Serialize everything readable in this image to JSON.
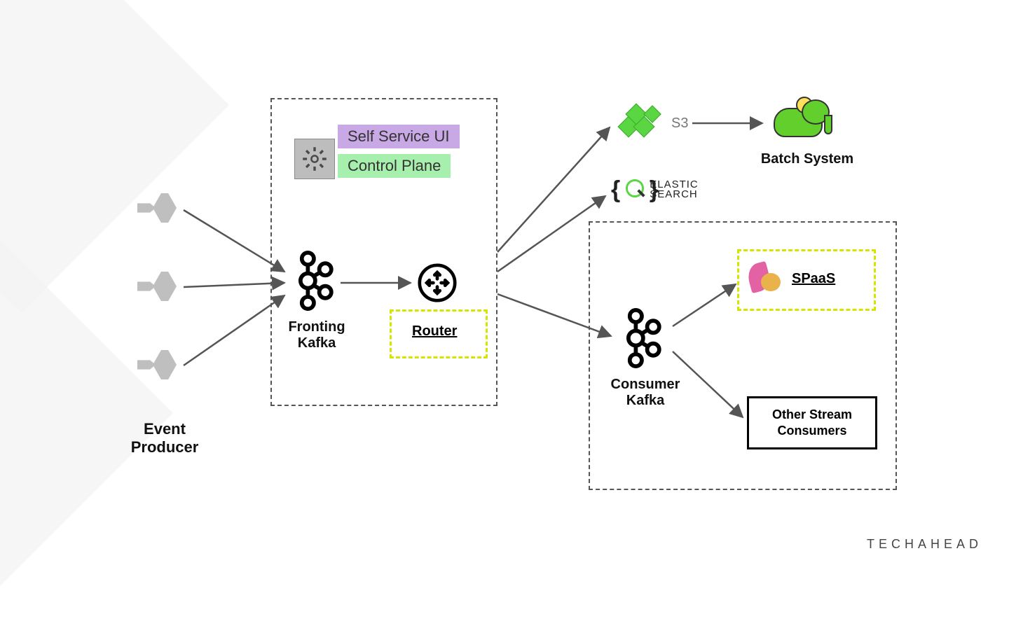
{
  "labels": {
    "event_producer": "Event\nProducer",
    "self_service_ui": "Self Service UI",
    "control_plane": "Control Plane",
    "fronting_kafka": "Fronting\nKafka",
    "router": "Router",
    "s3": "S3",
    "elastic1": "ELASTIC",
    "elastic2": "SEARCH",
    "batch_system": "Batch System",
    "consumer_kafka": "Consumer\nKafka",
    "spaas": "SPaaS",
    "other_stream_consumers": "Other Stream\nConsumers"
  },
  "brand": "TECHAHEAD",
  "colors": {
    "purple": "#c9a8e6",
    "green_bar": "#a7efac",
    "lime": "#59d642",
    "yellow_dash": "#d4e600"
  },
  "nodes": [
    {
      "id": "producer1",
      "type": "producer"
    },
    {
      "id": "producer2",
      "type": "producer"
    },
    {
      "id": "producer3",
      "type": "producer"
    },
    {
      "id": "gear",
      "type": "gear"
    },
    {
      "id": "fronting_kafka",
      "type": "kafka"
    },
    {
      "id": "router",
      "type": "router"
    },
    {
      "id": "s3",
      "type": "s3"
    },
    {
      "id": "elasticsearch",
      "type": "elasticsearch"
    },
    {
      "id": "hadoop",
      "type": "hadoop"
    },
    {
      "id": "consumer_kafka",
      "type": "kafka"
    },
    {
      "id": "spaas",
      "type": "spaas"
    },
    {
      "id": "other_consumers",
      "type": "box"
    }
  ],
  "edges": [
    {
      "from": "producer1",
      "to": "fronting_kafka"
    },
    {
      "from": "producer2",
      "to": "fronting_kafka"
    },
    {
      "from": "producer3",
      "to": "fronting_kafka"
    },
    {
      "from": "fronting_kafka",
      "to": "router"
    },
    {
      "from": "router",
      "to": "s3"
    },
    {
      "from": "router",
      "to": "elasticsearch"
    },
    {
      "from": "router",
      "to": "consumer_kafka"
    },
    {
      "from": "s3",
      "to": "hadoop"
    },
    {
      "from": "consumer_kafka",
      "to": "spaas"
    },
    {
      "from": "consumer_kafka",
      "to": "other_consumers"
    }
  ]
}
